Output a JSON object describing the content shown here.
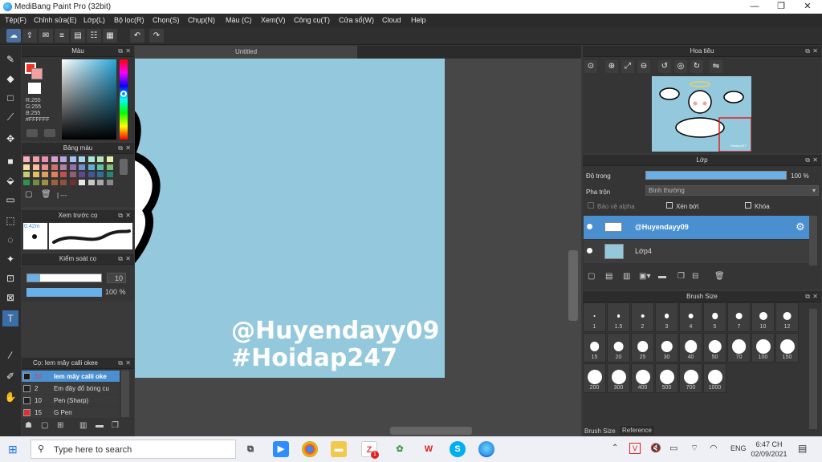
{
  "window": {
    "title": "MediBang Paint Pro (32bit)",
    "min": "—",
    "max": "❐",
    "close": "✕"
  },
  "menu": [
    "Tệp(F)",
    "Chỉnh sửa(E)",
    "Lớp(L)",
    "Bộ lọc(R)",
    "Chọn(S)",
    "Chụp(N)",
    "Màu (C)",
    "Xem(V)",
    "Công cụ(T)",
    "Cửa sổ(W)",
    "Cloud",
    "Help"
  ],
  "panels": {
    "color": {
      "title": "Màu",
      "r": "R:255",
      "g": "G:255",
      "b": "B:255",
      "hex": "#FFFFFF"
    },
    "palette": {
      "title": "Bảng màu",
      "footer": "| ---"
    },
    "brush_preview": {
      "title": "Xem trước cọ",
      "size": "0.42m"
    },
    "brush_control": {
      "title": "Kiểm soát cọ",
      "size_value": "10",
      "opacity_value": "100 %"
    },
    "brush_list": {
      "title": "Cọ: Iem mây calli okee",
      "items": [
        {
          "size": "10",
          "name": "Iem mây calli oke",
          "selected": true,
          "color": "#1a1a1a"
        },
        {
          "size": "2",
          "name": "Em đây đổ bóng cu",
          "selected": false,
          "color": "#222"
        },
        {
          "size": "10",
          "name": "Pen (Sharp)",
          "selected": false,
          "color": "#222"
        },
        {
          "size": "15",
          "name": "G Pen",
          "selected": false,
          "color": "#e03030"
        }
      ]
    },
    "navigator": {
      "title": "Hoa tiêu",
      "watermark": "Hoidap247"
    },
    "layer": {
      "title": "Lớp",
      "opacity_label": "Độ trong",
      "opacity_value": "100 %",
      "opacity_fraction": 1.0,
      "blend_label": "Pha trộn",
      "blend_value": "Bình thường",
      "protect_alpha": "Bảo vệ alpha",
      "clipping": "Xén bớt",
      "lock": "Khóa",
      "layers": [
        {
          "name": "@Huyendayy09",
          "selected": true
        },
        {
          "name": "Lớp4",
          "selected": false
        }
      ]
    },
    "brush_size": {
      "title": "Brush Size",
      "sizes": [
        "1",
        "1.5",
        "2",
        "3",
        "4",
        "5",
        "7",
        "10",
        "12",
        "15",
        "20",
        "25",
        "30",
        "40",
        "50",
        "70",
        "100",
        "150",
        "200",
        "300",
        "400",
        "500",
        "700",
        "1000"
      ],
      "tabs": [
        "Brush Size",
        "Reference"
      ]
    }
  },
  "canvas": {
    "tab_title": "Untitled",
    "text_line1": "@Huyendayy09",
    "text_line2": "#Hoidap247",
    "bg_color": "#94c8dc"
  },
  "taskbar": {
    "search_placeholder": "Type here to search",
    "language": "ENG",
    "time": "6:47 CH",
    "date": "02/09/2021",
    "badge": "1"
  },
  "colors": {
    "accent": "#4a90d9",
    "selected_row": "#4a8fd0",
    "slider": "#6ab0e8"
  }
}
